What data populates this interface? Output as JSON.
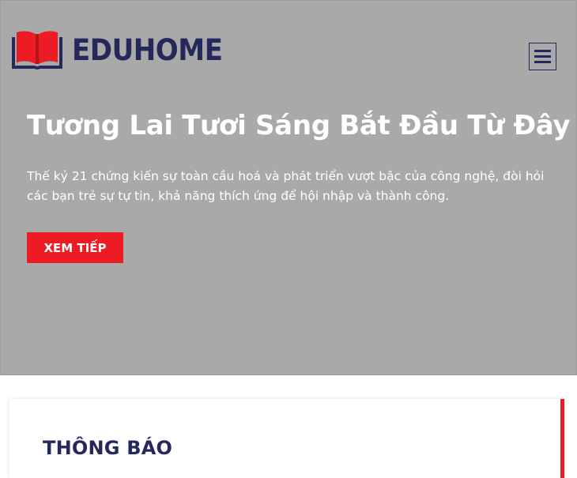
{
  "header": {
    "logo_text": "EDUHOME",
    "menu_icon": "hamburger-menu-icon"
  },
  "hero": {
    "title": "Tương Lai Tươi Sáng Bắt Đầu Từ Đây",
    "description": "Thế kỷ 21 chứng kiến sự toàn cầu hoá và phát triển vượt bậc của công nghệ, đòi hỏi các bạn trẻ sự tự tin, khả năng thích ứng để hội nhập và thành công.",
    "cta_label": "XEM TIẾP",
    "background_color": "#a9a9aa"
  },
  "notice": {
    "title": "THÔNG BÁO"
  },
  "colors": {
    "brand_navy": "#24285b",
    "accent_red": "#ed1c24"
  }
}
